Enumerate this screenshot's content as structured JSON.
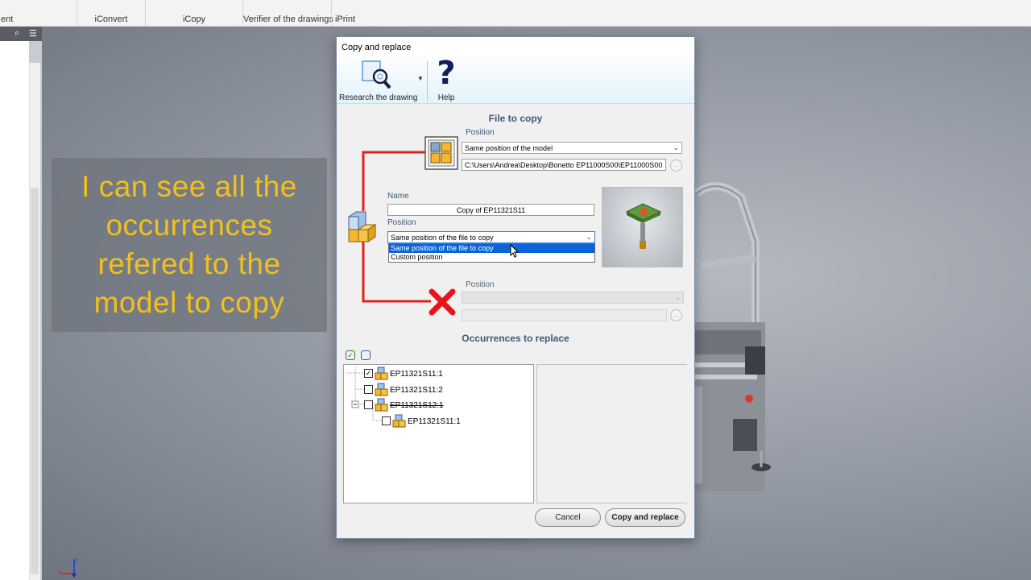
{
  "ribbon": {
    "groups": [
      "ent",
      "iConvert",
      "iCopy",
      "Verifier of the drawings",
      "iPrint"
    ]
  },
  "caption": {
    "text": "I can see all the\noccurrences\nrefered to the\nmodel to copy"
  },
  "dialog": {
    "title": "Copy and replace",
    "toolbar": {
      "research_label": "Research the drawing",
      "help_label": "Help"
    },
    "file_to_copy": {
      "title": "File to copy",
      "position_label": "Position",
      "position_value": "Same position of the model",
      "path_value": "C:\\Users\\Andrea\\Desktop\\Bonetto EP11000S00\\EP11000S00"
    },
    "new_file": {
      "name_label": "Name",
      "name_value": "Copy of EP11321S11",
      "position_label": "Position",
      "position_value": "Same position of the file to copy",
      "options": [
        "Same position of the file to copy",
        "Custom position"
      ]
    },
    "replace": {
      "position_label": "Position"
    },
    "occurrences": {
      "title": "Occurrences to replace",
      "items": [
        {
          "label": "EP11321S11:1",
          "checked": true
        },
        {
          "label": "EP11321S11:2",
          "checked": false
        },
        {
          "label": "EP11321S12:1",
          "checked": false
        },
        {
          "label": "EP11321S11:1",
          "checked": false
        }
      ]
    },
    "buttons": {
      "cancel": "Cancel",
      "ok": "Copy and replace"
    }
  },
  "colors": {
    "caption_text": "#f2c01e",
    "connector_red": "#e0201c",
    "section_title": "#3c5a78",
    "selection_blue": "#0a64d8"
  }
}
